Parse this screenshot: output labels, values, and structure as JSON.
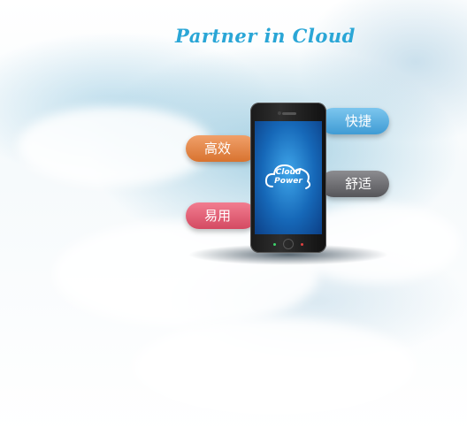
{
  "tagline": "Partner in Cloud",
  "phone": {
    "logo_line1": "Cloud",
    "logo_line2": "Power"
  },
  "features": [
    {
      "label": "快捷",
      "color": "#5ab2e2"
    },
    {
      "label": "高效",
      "color": "#e3854a"
    },
    {
      "label": "舒适",
      "color": "#6e6e72"
    },
    {
      "label": "易用",
      "color": "#e35a70"
    }
  ]
}
